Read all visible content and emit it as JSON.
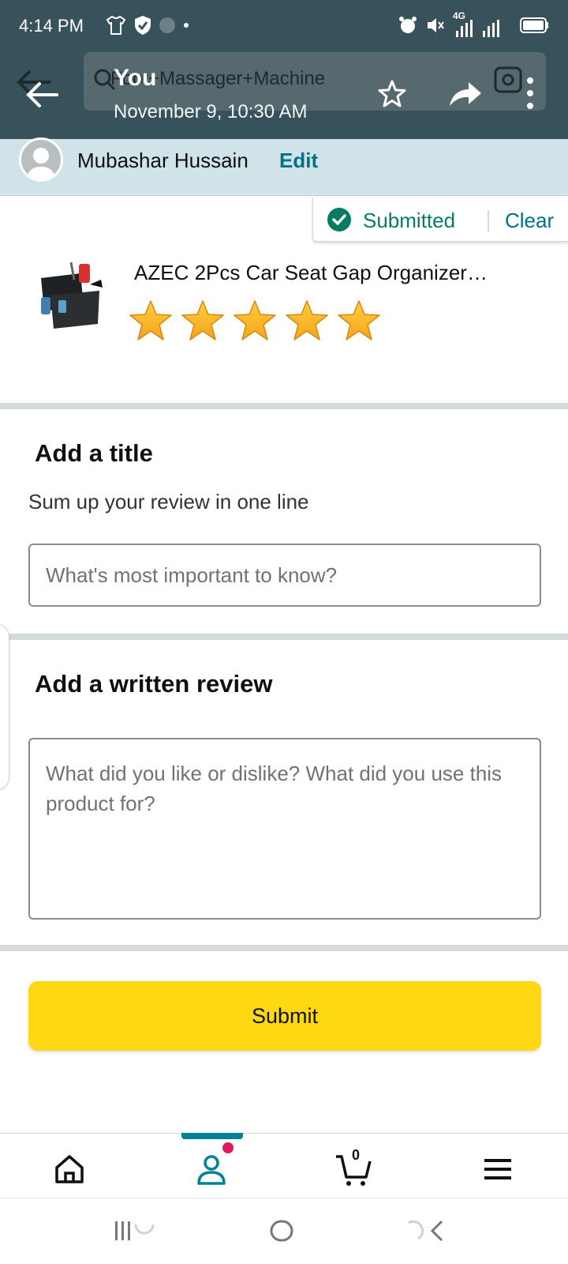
{
  "status_bar": {
    "time": "4:14 PM",
    "network_label": "4G"
  },
  "header": {
    "search_text": "Foot+Massager+Machine",
    "title": "You",
    "subtitle": "November 9, 10:30 AM",
    "icons": [
      "back-arrow-icon",
      "star-outline-icon",
      "share-arrow-icon",
      "camera-icon",
      "more-vertical-icon"
    ]
  },
  "profile": {
    "name": "Mubashar Hussain",
    "edit_label": "Edit"
  },
  "review_status": {
    "status": "Submitted",
    "clear_label": "Clear",
    "status_color": "#067d62"
  },
  "product": {
    "name": "AZEC 2Pcs Car Seat Gap Organizer…",
    "rating": 5,
    "rating_max": 5,
    "star_color": "#ffa41c"
  },
  "title_section": {
    "heading": "Add a title",
    "subheading": "Sum up your review in one line",
    "placeholder": "What's most important to know?",
    "value": ""
  },
  "review_section": {
    "heading": "Add a written review",
    "placeholder": "What did you like or dislike? What did you use this product for?",
    "value": ""
  },
  "submit": {
    "label": "Submit",
    "color": "#ffd814"
  },
  "bottom_nav": {
    "items": [
      "home-icon",
      "profile-icon",
      "cart-icon",
      "menu-icon"
    ],
    "active": "profile-icon",
    "cart_count": "0",
    "accent_color": "#008296"
  },
  "system_nav": {
    "items": [
      "recents-icon",
      "home-circle-icon",
      "back-chevron-icon"
    ]
  }
}
